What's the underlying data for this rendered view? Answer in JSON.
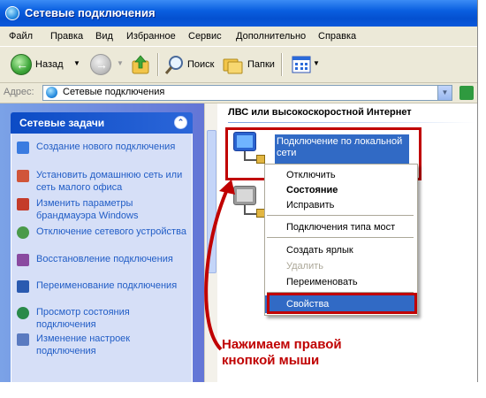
{
  "window": {
    "title": "Сетевые подключения"
  },
  "menu": [
    "Файл",
    "Правка",
    "Вид",
    "Избранное",
    "Сервис",
    "Дополнительно",
    "Справка"
  ],
  "toolbar": {
    "back_label": "Назад",
    "search_label": "Поиск",
    "folders_label": "Папки"
  },
  "address": {
    "label": "Адрес:",
    "value": "Сетевые подключения"
  },
  "left_pane": {
    "panel_title": "Сетевые задачи",
    "tasks": [
      {
        "label": "Создание нового подключения",
        "icon": "new-connection-icon",
        "color": "#3a7be0"
      },
      {
        "label": "Установить домашнюю сеть или сеть малого офиса",
        "icon": "home-network-icon",
        "color": "#d0553a"
      },
      {
        "label": "Изменить параметры брандмауэра Windows",
        "icon": "firewall-icon",
        "color": "#c43b2a"
      },
      {
        "label": "Отключение сетевого устройства",
        "icon": "disable-device-icon",
        "color": "#4a9a4a"
      },
      {
        "label": "Восстановление подключения",
        "icon": "repair-icon",
        "color": "#8a4aa0"
      },
      {
        "label": "Переименование подключения",
        "icon": "rename-icon",
        "color": "#2a5ab0"
      },
      {
        "label": "Просмотр состояния подключения",
        "icon": "status-icon",
        "color": "#2a8a4a"
      },
      {
        "label": "Изменение настроек подключения",
        "icon": "settings-icon",
        "color": "#5a7ac0"
      }
    ]
  },
  "right_pane": {
    "group_header": "ЛВС или высокоскоростной Интернет",
    "selected_connection": "Подключение по локальной сети"
  },
  "context_menu": {
    "items": [
      {
        "label": "Отключить",
        "bold": false,
        "disabled": false
      },
      {
        "label": "Состояние",
        "bold": true,
        "disabled": false
      },
      {
        "label": "Исправить",
        "bold": false,
        "disabled": false
      },
      {
        "label": "Подключения типа мост",
        "bold": false,
        "disabled": false
      },
      {
        "label": "Создать ярлык",
        "bold": false,
        "disabled": false
      },
      {
        "label": "Удалить",
        "bold": false,
        "disabled": true
      },
      {
        "label": "Переименовать",
        "bold": false,
        "disabled": false
      },
      {
        "label": "Свойства",
        "bold": false,
        "disabled": false,
        "selected": true
      }
    ]
  },
  "annotation": {
    "line1": "Нажимаем правой",
    "line2": "кнопкой мыши",
    "color": "#c00000"
  }
}
